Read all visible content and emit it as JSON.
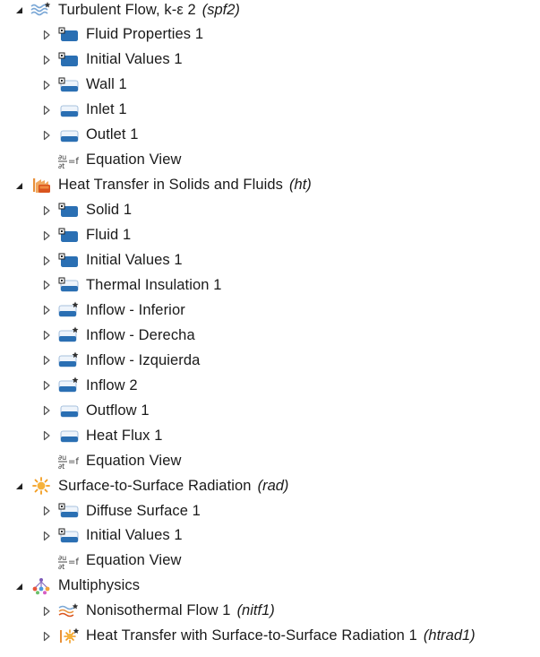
{
  "tree": [
    {
      "label": "Turbulent Flow, k-ε 2",
      "tag": "(spf2)",
      "level": 0,
      "toggle": "expanded",
      "icon": "turbulent-flow-icon"
    },
    {
      "label": "Fluid Properties 1",
      "level": 1,
      "toggle": "collapsed",
      "icon": "domain-node-icon"
    },
    {
      "label": "Initial Values 1",
      "level": 1,
      "toggle": "collapsed",
      "icon": "domain-node-icon"
    },
    {
      "label": "Wall 1",
      "level": 1,
      "toggle": "collapsed",
      "icon": "boundary-node-icon"
    },
    {
      "label": "Inlet 1",
      "level": 1,
      "toggle": "collapsed",
      "icon": "boundary-plain-icon"
    },
    {
      "label": "Outlet 1",
      "level": 1,
      "toggle": "collapsed",
      "icon": "boundary-plain-icon"
    },
    {
      "label": "Equation View",
      "level": 1,
      "toggle": "none",
      "icon": "equation-view-icon"
    },
    {
      "label": "Heat Transfer in Solids and Fluids",
      "tag": "(ht)",
      "level": 0,
      "toggle": "expanded",
      "icon": "heat-transfer-icon"
    },
    {
      "label": "Solid 1",
      "level": 1,
      "toggle": "collapsed",
      "icon": "domain-node-icon"
    },
    {
      "label": "Fluid 1",
      "level": 1,
      "toggle": "collapsed",
      "icon": "domain-node-icon"
    },
    {
      "label": "Initial Values 1",
      "level": 1,
      "toggle": "collapsed",
      "icon": "domain-node-icon"
    },
    {
      "label": "Thermal Insulation 1",
      "level": 1,
      "toggle": "collapsed",
      "icon": "boundary-node-icon"
    },
    {
      "label": "Inflow - Inferior",
      "level": 1,
      "toggle": "collapsed",
      "icon": "boundary-star-icon"
    },
    {
      "label": "Inflow - Derecha",
      "level": 1,
      "toggle": "collapsed",
      "icon": "boundary-star-icon"
    },
    {
      "label": "Inflow - Izquierda",
      "level": 1,
      "toggle": "collapsed",
      "icon": "boundary-star-icon"
    },
    {
      "label": "Inflow 2",
      "level": 1,
      "toggle": "collapsed",
      "icon": "boundary-star-icon"
    },
    {
      "label": "Outflow 1",
      "level": 1,
      "toggle": "collapsed",
      "icon": "boundary-plain-icon"
    },
    {
      "label": "Heat Flux 1",
      "level": 1,
      "toggle": "collapsed",
      "icon": "boundary-plain-icon"
    },
    {
      "label": "Equation View",
      "level": 1,
      "toggle": "none",
      "icon": "equation-view-icon"
    },
    {
      "label": "Surface-to-Surface Radiation",
      "tag": "(rad)",
      "level": 0,
      "toggle": "expanded",
      "icon": "radiation-sun-icon"
    },
    {
      "label": "Diffuse Surface 1",
      "level": 1,
      "toggle": "collapsed",
      "icon": "boundary-node-icon"
    },
    {
      "label": "Initial Values 1",
      "level": 1,
      "toggle": "collapsed",
      "icon": "boundary-node-icon"
    },
    {
      "label": "Equation View",
      "level": 1,
      "toggle": "none",
      "icon": "equation-view-icon"
    },
    {
      "label": "Multiphysics",
      "level": 0,
      "toggle": "expanded",
      "icon": "multiphysics-icon"
    },
    {
      "label": "Nonisothermal Flow 1",
      "tag": "(nitf1)",
      "level": 1,
      "toggle": "collapsed",
      "icon": "nonisothermal-flow-icon"
    },
    {
      "label": "Heat Transfer with Surface-to-Surface Radiation 1",
      "tag": "(htrad1)",
      "level": 1,
      "toggle": "collapsed",
      "icon": "heat-radiation-coupling-icon"
    }
  ]
}
